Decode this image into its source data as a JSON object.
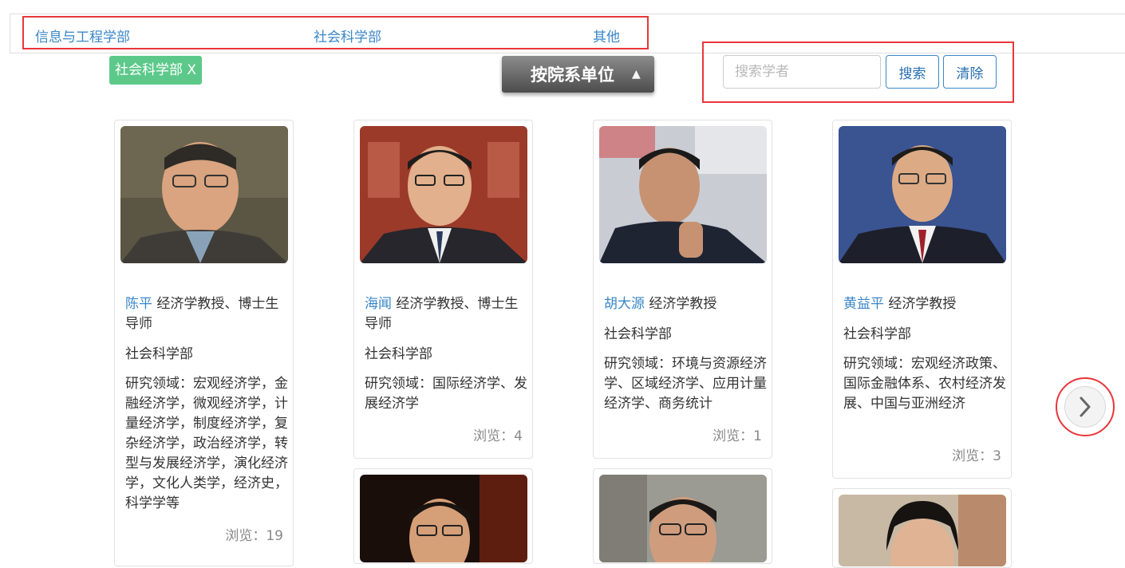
{
  "departments": [
    "信息与工程学部",
    "社会科学部",
    "其他"
  ],
  "active_filter": "社会科学部 X",
  "sort_button": {
    "label": "按院系单位",
    "arrow": "▲"
  },
  "search": {
    "placeholder": "搜索学者",
    "search_label": "搜索",
    "clear_label": "清除"
  },
  "scholars": [
    {
      "name": "陈平",
      "title": "经济学教授、博士生导师",
      "dept": "社会科学部",
      "research": "研究领域：宏观经济学，金融经济学，微观经济学，计量经济学，制度经济学，复杂经济学，政治经济学，转型与发展经济学，演化经济学，文化人类学，经济史，科学学等",
      "views": "浏览：19"
    },
    {
      "name": "海闻",
      "title": "经济学教授、博士生导师",
      "dept": "社会科学部",
      "research": "研究领域：国际经济学、发展经济学",
      "views": "浏览：4"
    },
    {
      "name": "胡大源",
      "title": "经济学教授",
      "dept": "社会科学部",
      "research": "研究领域：环境与资源经济学、区域经济学、应用计量经济学、商务统计",
      "views": "浏览：1"
    },
    {
      "name": "黄益平",
      "title": "经济学教授",
      "dept": "社会科学部",
      "research": "研究领域：宏观经济政策、国际金融体系、农村经济发展、中国与亚洲经济",
      "views": "浏览：3"
    }
  ],
  "next_icon": "chevron-right-icon",
  "colors": {
    "link": "#3a87c8",
    "tag": "#5cc98a",
    "highlight": "#e8363b"
  }
}
